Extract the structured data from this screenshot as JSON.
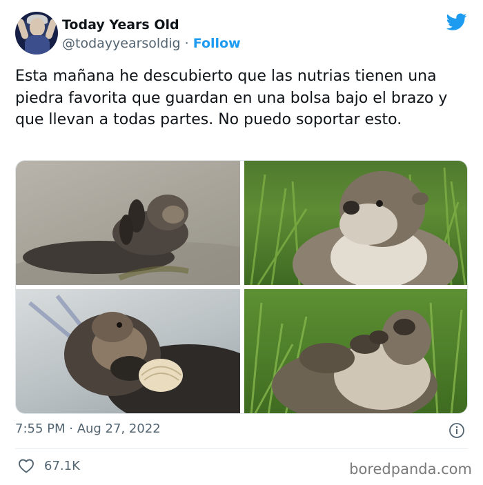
{
  "author": {
    "display_name": "Today Years Old",
    "handle": "@todayyearsoldig",
    "separator": "·",
    "follow_label": "Follow",
    "avatar_icon": "person-avatar"
  },
  "tweet": {
    "text": "Esta mañana he descubierto que las nutrias tienen una piedra favorita que guardan en una bolsa bajo el brazo y que llevan a todas partes. No puedo soportar esto.",
    "photos": [
      {
        "name": "sea-otter-floating-photo"
      },
      {
        "name": "river-otter-grass-photo"
      },
      {
        "name": "sea-otter-clam-photo"
      },
      {
        "name": "otter-on-back-grass-photo"
      }
    ],
    "timestamp": "7:55 PM · Aug 27, 2022",
    "likes": "67.1K"
  },
  "watermark": "boredpanda.com",
  "colors": {
    "accent": "#1d9bf0",
    "text_primary": "#0f1419",
    "text_secondary": "#536471"
  }
}
